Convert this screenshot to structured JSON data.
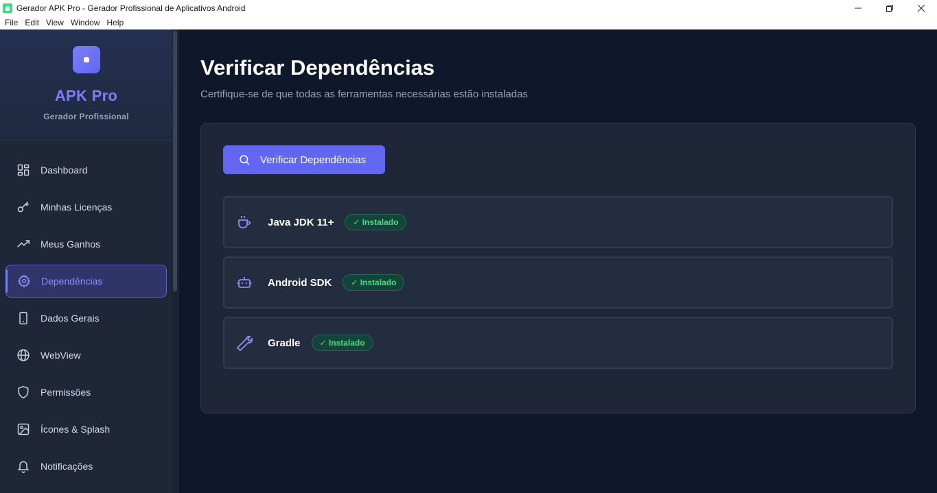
{
  "window": {
    "title": "Gerador APK Pro - Gerador Profissional de Aplicativos Android",
    "controls": [
      "minimize-icon",
      "restore-icon",
      "close-icon"
    ]
  },
  "menubar": {
    "items": [
      "File",
      "Edit",
      "View",
      "Window",
      "Help"
    ]
  },
  "sidebar": {
    "brand": "APK Pro",
    "subtitle": "Gerador Profissional",
    "items": [
      {
        "label": "Dashboard",
        "icon": "grid-icon"
      },
      {
        "label": "Minhas Licenças",
        "icon": "key-icon"
      },
      {
        "label": "Meus Ganhos",
        "icon": "trending-up-icon"
      },
      {
        "label": "Dependências",
        "icon": "gear-icon",
        "active": true
      },
      {
        "label": "Dados Gerais",
        "icon": "smartphone-icon"
      },
      {
        "label": "WebView",
        "icon": "globe-icon"
      },
      {
        "label": "Permissões",
        "icon": "shield-icon"
      },
      {
        "label": "Ícones & Splash",
        "icon": "image-icon"
      },
      {
        "label": "Notificações",
        "icon": "bell-icon"
      }
    ]
  },
  "main": {
    "title": "Verificar Dependências",
    "subtitle": "Certifique-se de que todas as ferramentas necessárias estão instaladas",
    "verify_button": "Verificar Dependências",
    "dependencies": [
      {
        "name": "Java JDK 11+",
        "status": "✓ Instalado",
        "icon": "coffee-icon"
      },
      {
        "name": "Android SDK",
        "status": "✓ Instalado",
        "icon": "robot-icon"
      },
      {
        "name": "Gradle",
        "status": "✓ Instalado",
        "icon": "wrench-icon"
      }
    ]
  },
  "colors": {
    "accent": "#6366f1",
    "success": "#4ade80",
    "background": "#0f172a",
    "sidebar": "#1e2638"
  }
}
